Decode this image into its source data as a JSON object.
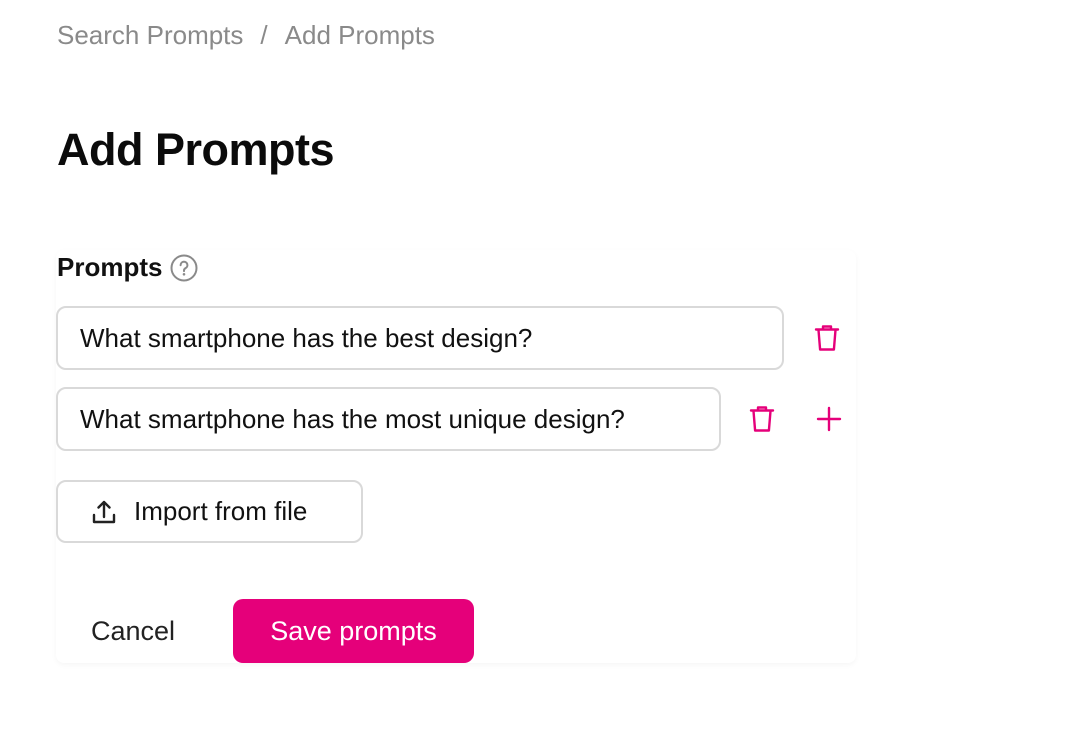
{
  "breadcrumb": {
    "items": [
      "Search Prompts",
      "Add Prompts"
    ],
    "separator": "/"
  },
  "page": {
    "title": "Add Prompts"
  },
  "form": {
    "label": "Prompts",
    "help_icon": "question-circle-icon",
    "prompts": [
      {
        "value": "What smartphone has the best design?"
      },
      {
        "value": "What smartphone has the most unique design?"
      }
    ],
    "delete_icon": "trash-icon",
    "add_icon": "plus-icon",
    "import_label": "Import from file",
    "import_icon": "upload-icon"
  },
  "actions": {
    "cancel_label": "Cancel",
    "save_label": "Save prompts"
  },
  "colors": {
    "accent": "#e5007a",
    "muted_text": "#8a8a8a",
    "border": "#d9d9d9"
  }
}
